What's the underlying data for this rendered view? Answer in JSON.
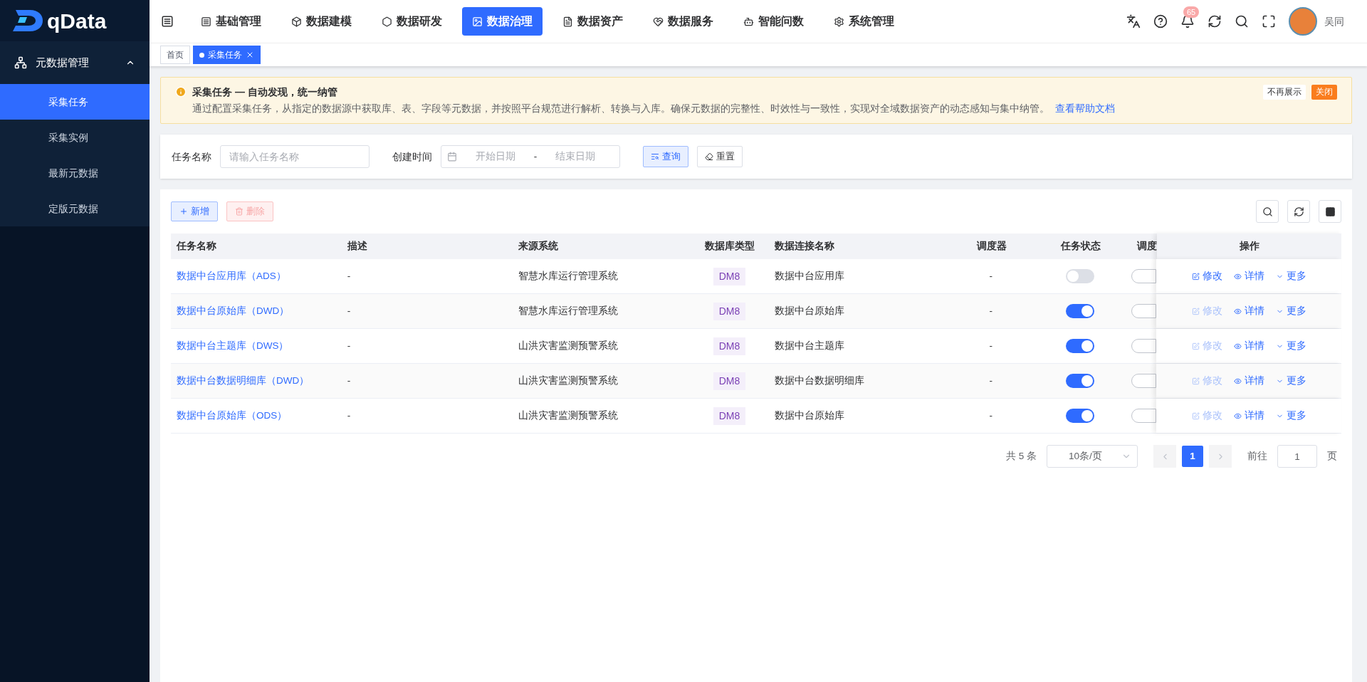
{
  "logo": {
    "text": "qData"
  },
  "sidebar": {
    "group": {
      "label": "元数据管理",
      "expanded": true
    },
    "items": [
      {
        "label": "采集任务",
        "selected": true
      },
      {
        "label": "采集实例",
        "selected": false
      },
      {
        "label": "最新元数据",
        "selected": false
      },
      {
        "label": "定版元数据",
        "selected": false
      }
    ]
  },
  "top_nav": [
    {
      "label": "基础管理",
      "selected": false,
      "kind": "base"
    },
    {
      "label": "数据建模",
      "selected": false,
      "kind": "model"
    },
    {
      "label": "数据研发",
      "selected": false,
      "kind": "dev"
    },
    {
      "label": "数据治理",
      "selected": true,
      "kind": "govern"
    },
    {
      "label": "数据资产",
      "selected": false,
      "kind": "asset"
    },
    {
      "label": "数据服务",
      "selected": false,
      "kind": "service"
    },
    {
      "label": "智能问数",
      "selected": false,
      "kind": "ai"
    },
    {
      "label": "系统管理",
      "selected": false,
      "kind": "system"
    }
  ],
  "header": {
    "notifications": "65",
    "user": "吴同"
  },
  "page_tabs": [
    {
      "label": "首页",
      "selected": false,
      "closable": false
    },
    {
      "label": "采集任务",
      "selected": true,
      "closable": true
    }
  ],
  "notice": {
    "title": "采集任务 — 自动发现，统一纳管",
    "text": "通过配置采集任务，从指定的数据源中获取库、表、字段等元数据，并按照平台规范进行解析、转换与入库。确保元数据的完整性、时效性与一致性，实现对全域数据资产的动态感知与集中纳管。",
    "link": "查看帮助文档",
    "hide_button": "不再展示",
    "close_button": "关闭"
  },
  "filter": {
    "name_label": "任务名称",
    "name_placeholder": "请输入任务名称",
    "time_label": "创建时间",
    "start_placeholder": "开始日期",
    "separator": "-",
    "end_placeholder": "结束日期",
    "query_button": "查询",
    "reset_button": "重置"
  },
  "toolbar": {
    "add_button": "新增",
    "delete_button": "删除",
    "delete_disabled": true
  },
  "table": {
    "columns": [
      "任务名称",
      "描述",
      "来源系统",
      "数据库类型",
      "数据连接名称",
      "调度器",
      "任务状态",
      "调度",
      "操作"
    ],
    "rows": [
      {
        "name": "数据中台应用库（ADS）",
        "description": "-",
        "source": "智慧水库运行管理系统",
        "db_type": "DM8",
        "connection": "数据中台应用库",
        "scheduler": "-",
        "task_on": false,
        "schedule_on": false,
        "edit": "修改",
        "edit_disabled": false,
        "detail": "详情",
        "more": "更多"
      },
      {
        "name": "数据中台原始库（DWD）",
        "description": "-",
        "source": "智慧水库运行管理系统",
        "db_type": "DM8",
        "connection": "数据中台原始库",
        "scheduler": "-",
        "task_on": true,
        "schedule_on": false,
        "edit": "修改",
        "edit_disabled": true,
        "detail": "详情",
        "more": "更多"
      },
      {
        "name": "数据中台主题库（DWS）",
        "description": "-",
        "source": "山洪灾害监测预警系统",
        "db_type": "DM8",
        "connection": "数据中台主题库",
        "scheduler": "-",
        "task_on": true,
        "schedule_on": false,
        "edit": "修改",
        "edit_disabled": true,
        "detail": "详情",
        "more": "更多"
      },
      {
        "name": "数据中台数据明细库（DWD）",
        "description": "-",
        "source": "山洪灾害监测预警系统",
        "db_type": "DM8",
        "connection": "数据中台数据明细库",
        "scheduler": "-",
        "task_on": true,
        "schedule_on": false,
        "edit": "修改",
        "edit_disabled": true,
        "detail": "详情",
        "more": "更多"
      },
      {
        "name": "数据中台原始库（ODS）",
        "description": "-",
        "source": "山洪灾害监测预警系统",
        "db_type": "DM8",
        "connection": "数据中台原始库",
        "scheduler": "-",
        "task_on": true,
        "schedule_on": false,
        "edit": "修改",
        "edit_disabled": true,
        "detail": "详情",
        "more": "更多"
      }
    ]
  },
  "pagination": {
    "total": "共 5 条",
    "page_size": "10条/页",
    "pages": [
      {
        "label": "1",
        "selected": true
      }
    ],
    "goto_label": "前往",
    "goto_value": "1",
    "page_suffix": "页"
  }
}
